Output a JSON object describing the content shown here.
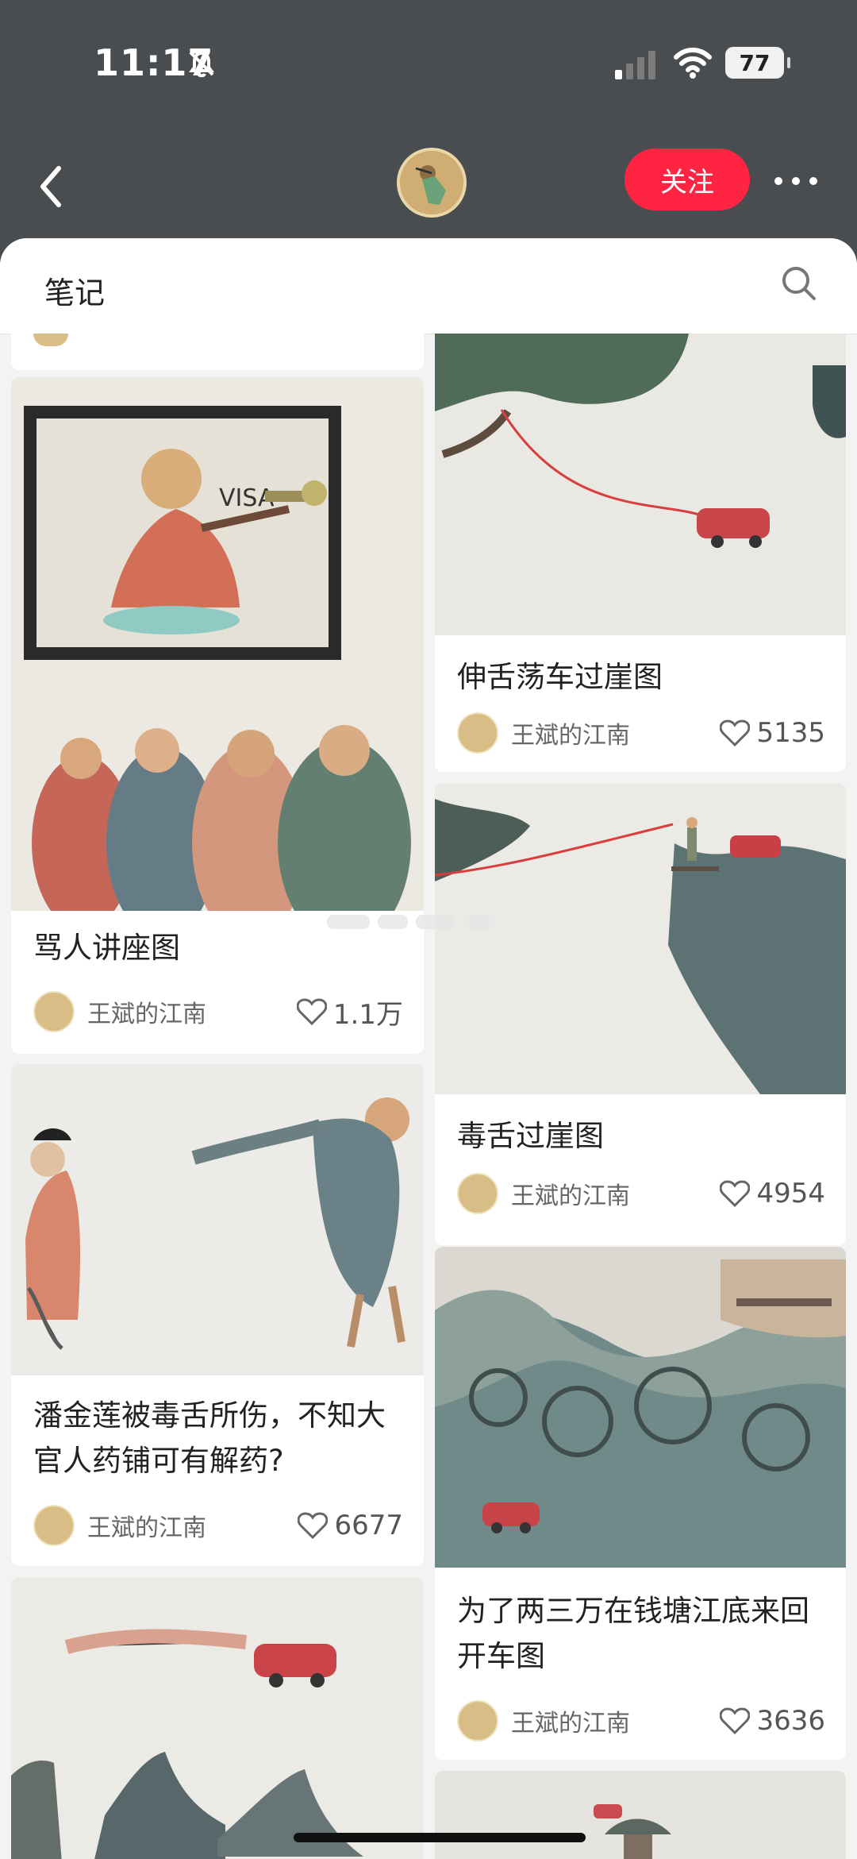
{
  "statusbar": {
    "time": "11:17",
    "battery": "77"
  },
  "nav": {
    "follow_label": "关注"
  },
  "sheet": {
    "title": "笔记"
  },
  "notes": [
    {
      "title": "骂人讲座图",
      "author": "王斌的江南",
      "likes": "1.1万"
    },
    {
      "title": "伸舌荡车过崖图",
      "author": "王斌的江南",
      "likes": "5135"
    },
    {
      "title": "毒舌过崖图",
      "author": "王斌的江南",
      "likes": "4954"
    },
    {
      "title": "潘金莲被毒舌所伤，不知大官人药铺可有解药?",
      "author": "王斌的江南",
      "likes": "6677"
    },
    {
      "title": "为了两三万在钱塘江底来回开车图",
      "author": "王斌的江南",
      "likes": "3636"
    }
  ],
  "colors": {
    "brand_red": "#ff2442",
    "top_bg": "#4a4d4f",
    "sheet_bg": "#f3f3f3"
  }
}
